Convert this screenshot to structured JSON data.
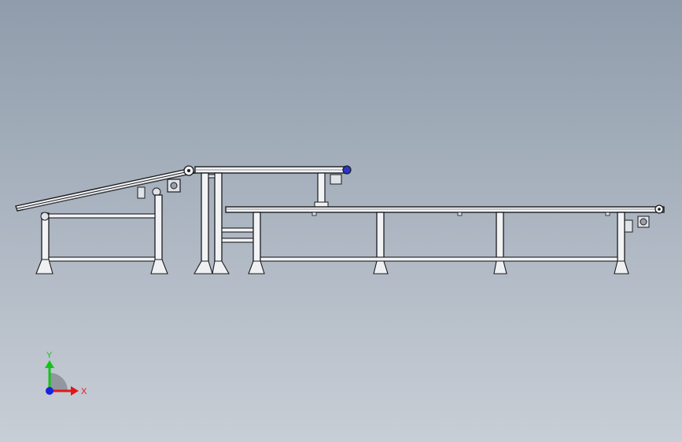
{
  "viewport": {
    "background_top": "#8f9cab",
    "background_bottom": "#c8ced6"
  },
  "colors": {
    "frame_light": "#f2f3f5",
    "frame_dark": "#1b1c1f",
    "frame_mid": "#9aa1aa",
    "roller_accent": "#2b35c8",
    "axis_x": "#e0161a",
    "axis_y": "#16c21a",
    "axis_z": "#1623e0"
  },
  "triad": {
    "x_label": "X",
    "y_label": "Y",
    "x_icon": "arrow-x-icon",
    "y_icon": "arrow-y-icon",
    "z_icon": "origin-z-icon"
  },
  "model": {
    "assembly": [
      {
        "name": "inclined-conveyor",
        "type": "incline",
        "legs": 2
      },
      {
        "name": "upper-conveyor",
        "type": "flat",
        "legs": 3
      },
      {
        "name": "long-conveyor",
        "type": "flat",
        "legs": 5
      }
    ]
  }
}
